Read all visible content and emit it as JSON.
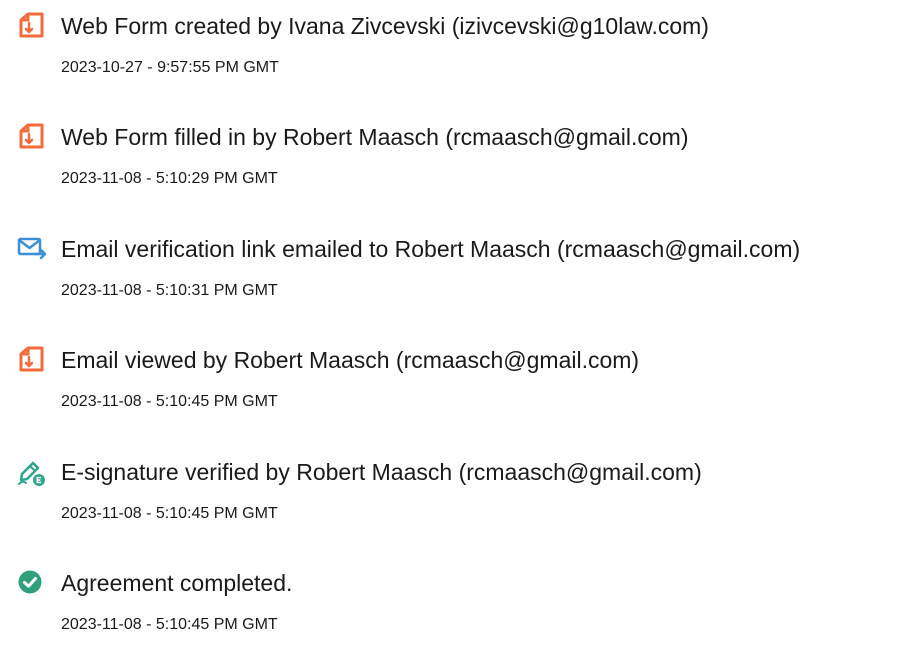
{
  "events": [
    {
      "title": "Web Form created by Ivana Zivcevski (izivcevski@g10law.com)",
      "time": "2023-10-27 - 9:57:55 PM GMT",
      "icon": "document-pdf-icon"
    },
    {
      "title": "Web Form filled in by Robert Maasch (rcmaasch@gmail.com)",
      "time": "2023-11-08 - 5:10:29 PM GMT",
      "icon": "document-pdf-icon"
    },
    {
      "title": "Email verification link emailed to Robert Maasch (rcmaasch@gmail.com)",
      "time": "2023-11-08 - 5:10:31 PM GMT",
      "icon": "email-send-icon"
    },
    {
      "title": "Email viewed by Robert Maasch (rcmaasch@gmail.com)",
      "time": "2023-11-08 - 5:10:45 PM GMT",
      "icon": "document-pdf-icon"
    },
    {
      "title": "E-signature verified by Robert Maasch (rcmaasch@gmail.com)",
      "time": "2023-11-08 - 5:10:45 PM GMT",
      "icon": "pen-verified-icon"
    },
    {
      "title": "Agreement completed.",
      "time": "2023-11-08 - 5:10:45 PM GMT",
      "icon": "check-circle-icon"
    }
  ],
  "colors": {
    "document_icon": "#f26b3a",
    "email_icon": "#3a8fd6",
    "signature_icon": "#2fa58f",
    "check_icon": "#2fa07a",
    "text": "#1a1a1a"
  }
}
